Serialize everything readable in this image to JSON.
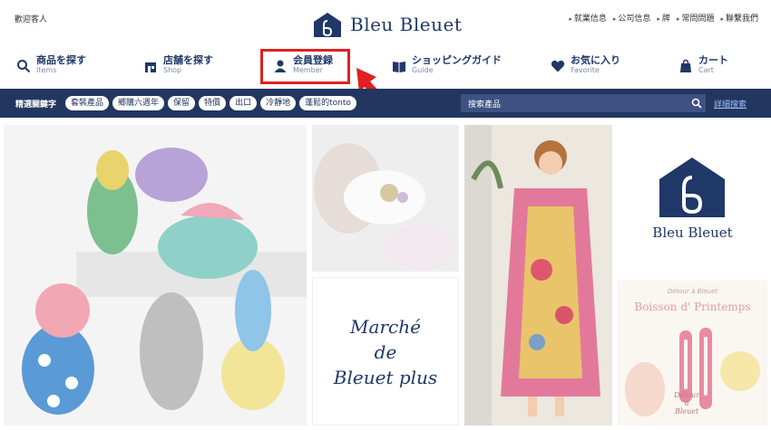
{
  "header": {
    "welcome": "歡迎客人",
    "logo_text": "Bleu Bleuet",
    "top_links": [
      "就業信息",
      "公司信息",
      "牌",
      "常問問題",
      "聯繫我們"
    ]
  },
  "nav": [
    {
      "jp": "商品を探す",
      "en": "Items",
      "icon": "search-icon"
    },
    {
      "jp": "店舗を探す",
      "en": "Shop",
      "icon": "shop-icon"
    },
    {
      "jp": "会員登録",
      "en": "Member",
      "icon": "member-icon"
    },
    {
      "jp": "ショッピングガイド",
      "en": "Guide",
      "icon": "book-icon"
    },
    {
      "jp": "お気に入り",
      "en": "Favorite",
      "icon": "heart-icon"
    },
    {
      "jp": "カート",
      "en": "Cart",
      "icon": "cart-icon"
    }
  ],
  "keywords": {
    "label": "精選關鍵字",
    "tags": [
      "套裝產品",
      "鄉購六週年",
      "保留",
      "特價",
      "出口",
      "冷靜地",
      "蓬鬆的tonto"
    ]
  },
  "search": {
    "placeholder": "搜索產品",
    "advanced": "詳細搜索"
  },
  "tiles": {
    "marche": [
      "Marché",
      "de",
      "Bleuet plus"
    ],
    "brand": "Bleu Bleuet",
    "boisson": "Boisson d' Printemps",
    "detour_top": "Détour à Bleuet",
    "detour_bottom": [
      "Détour",
      "à",
      "Bleuet"
    ]
  },
  "colors": {
    "navy": "#23365f",
    "highlight": "#e02020"
  }
}
